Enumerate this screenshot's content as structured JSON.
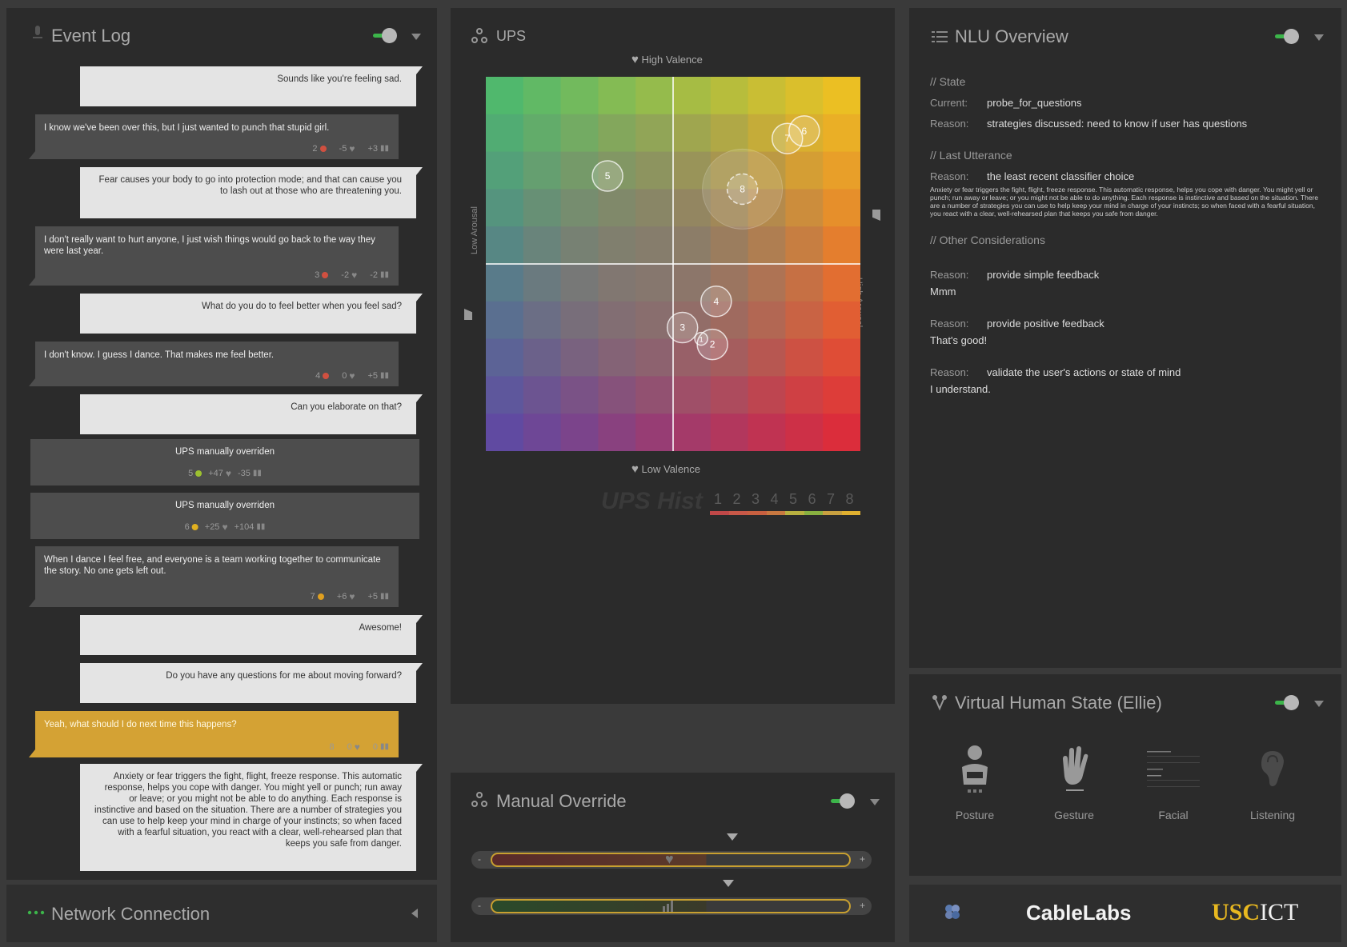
{
  "event_log": {
    "title": "Event Log",
    "messages": [
      {
        "role": "ellie",
        "text": "Sounds like you're feeling sad."
      },
      {
        "role": "user",
        "text": "I know we've been over this, but I just wanted to punch that stupid girl.",
        "count": "2",
        "dot_color": "#d05040",
        "valence": "-5",
        "arousal": "+3"
      },
      {
        "role": "ellie",
        "text": "Fear causes your body to go into protection mode; and that can cause you to lash out at those who are threatening you."
      },
      {
        "role": "user",
        "text": "I don't really want to hurt anyone, I just wish things would go back to the way they were last year.",
        "count": "3",
        "dot_color": "#d05040",
        "valence": "-2",
        "arousal": "-2"
      },
      {
        "role": "ellie",
        "text": "What do you do to feel better when you feel sad?"
      },
      {
        "role": "user",
        "text": "I don't know. I guess I dance. That makes me feel better.",
        "count": "4",
        "dot_color": "#d05040",
        "valence": "0",
        "arousal": "+5"
      },
      {
        "role": "ellie",
        "text": "Can you elaborate on that?"
      },
      {
        "role": "system",
        "text": "UPS manually overriden",
        "count": "5",
        "dot_color": "#9cc030",
        "valence": "+47",
        "arousal": "-35"
      },
      {
        "role": "system",
        "text": "UPS manually overriden",
        "count": "6",
        "dot_color": "#e0b020",
        "valence": "+25",
        "arousal": "+104"
      },
      {
        "role": "user",
        "text": "When I dance I feel free, and everyone is a team working together to communicate the story. No one gets left out.",
        "count": "7",
        "dot_color": "#e0a020",
        "valence": "+6",
        "arousal": "+5"
      },
      {
        "role": "ellie",
        "text": "Awesome!"
      },
      {
        "role": "ellie",
        "text": "Do you have any questions for me about moving forward?"
      },
      {
        "role": "user_highlight",
        "text": "Yeah, what should I do next time this happens?",
        "count": "8",
        "valence": "0",
        "arousal": "0"
      },
      {
        "role": "ellie",
        "text": "Anxiety or fear triggers the fight, flight, freeze response. This automatic response, helps you cope with danger. You might yell or punch; run away or leave; or you might not be able to do anything. Each response is instinctive and based on the situation. There are a number of strategies you can use to help keep your mind in charge of your instincts; so when faced with a fearful situation, you react with a clear, well-rehearsed plan that keeps you safe from danger."
      }
    ]
  },
  "network": {
    "title": "Network Connection"
  },
  "ups": {
    "title": "UPS",
    "high_valence": "High Valence",
    "low_valence": "Low Valence",
    "low_arousal": "Low Arousal",
    "high_arousal": "High Arousal",
    "hist_label": "UPS Hist",
    "hist_numbers": [
      "1",
      "2",
      "3",
      "4",
      "5",
      "6",
      "7",
      "8"
    ],
    "hist_colors": [
      "#c04848",
      "#c85848",
      "#c86040",
      "#c87840",
      "#b8b040",
      "#88b040",
      "#c8a040",
      "#e0b030"
    ],
    "markers": [
      {
        "label": "2",
        "v": 0.21,
        "a": -0.43
      },
      {
        "label": "3",
        "v": 0.05,
        "a": -0.34
      },
      {
        "label": "1",
        "v": 0.15,
        "a": -0.4
      },
      {
        "label": "4",
        "v": 0.23,
        "a": -0.2
      },
      {
        "label": "5",
        "v": -0.35,
        "a": 0.47
      },
      {
        "label": "6",
        "v": 0.7,
        "a": 0.71
      },
      {
        "label": "7",
        "v": 0.61,
        "a": 0.67
      },
      {
        "label": "8",
        "v": 0.37,
        "a": 0.4
      }
    ]
  },
  "manual_override": {
    "title": "Manual Override",
    "minus": "-",
    "plus": "+",
    "valence_level": 0.67,
    "arousal_level": 0.66
  },
  "nlu": {
    "title": "NLU Overview",
    "state_header": "// State",
    "current_label": "Current:",
    "current_value": "probe_for_questions",
    "reason_label": "Reason:",
    "state_reason": "strategies discussed: need to know if user has questions",
    "last_utterance_header": "// Last Utterance",
    "last_reason": "the least recent classifier choice",
    "last_text": "Anxiety or fear triggers the fight, flight, freeze response. This automatic response, helps you cope with danger. You might yell or punch; run away or leave; or you might not be able to do anything. Each response is instinctive and based on the situation. There are a number of strategies you can use to help keep your mind in charge of your instincts; so when faced with a fearful situation, you react with a clear, well-rehearsed plan that keeps you safe from danger.",
    "other_header": "// Other Considerations",
    "others": [
      {
        "reason": "provide simple feedback",
        "text": "Mmm"
      },
      {
        "reason": "provide positive feedback",
        "text": "That's good!"
      },
      {
        "reason": "validate the user's actions or state of mind",
        "text": "I understand."
      }
    ]
  },
  "vh_state": {
    "title": "Virtual Human State (Ellie)",
    "items": [
      "Posture",
      "Gesture",
      "Facial",
      "Listening"
    ]
  },
  "footer": {
    "cablelabs": "CableLabs",
    "usc": "USC",
    "ict": "ICT"
  }
}
